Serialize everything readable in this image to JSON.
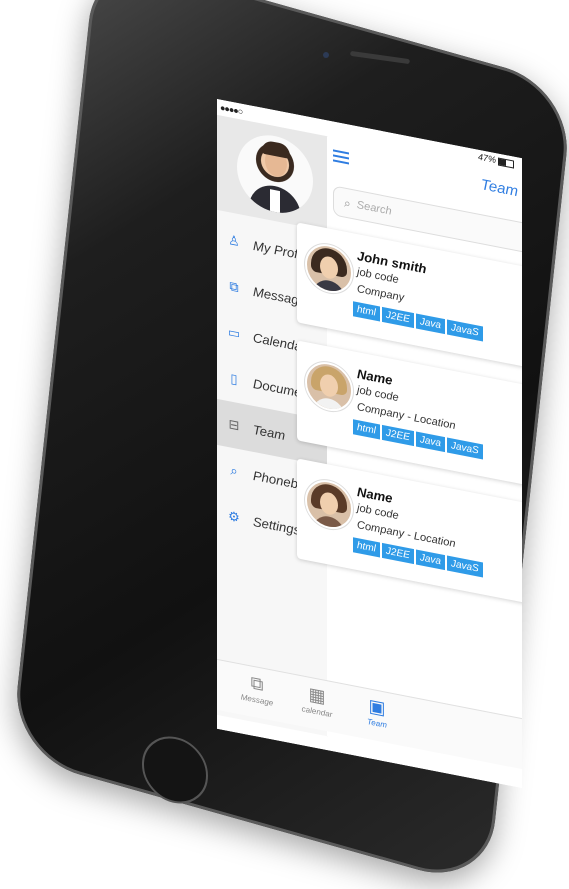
{
  "statusbar": {
    "signal": "●●●●○",
    "battery": "47%"
  },
  "header": {
    "title": "Team"
  },
  "search": {
    "placeholder": "Search"
  },
  "sidebar": {
    "items": [
      {
        "label": "My Profile",
        "icon": "user-icon",
        "glyph": "♙"
      },
      {
        "label": "Messages",
        "icon": "messages-icon",
        "glyph": "⧉"
      },
      {
        "label": "Calendar",
        "icon": "calendar-icon",
        "glyph": "▭"
      },
      {
        "label": "Documents",
        "icon": "document-icon",
        "glyph": "▯"
      },
      {
        "label": "Team",
        "icon": "briefcase-icon",
        "glyph": "⊟"
      },
      {
        "label": "Phonebook",
        "icon": "search-icon",
        "glyph": "⌕"
      },
      {
        "label": "Settings",
        "icon": "gear-icon",
        "glyph": "⚙"
      }
    ]
  },
  "team": {
    "members": [
      {
        "name": "John smith",
        "job": "job code",
        "company": "Company",
        "tags": [
          "html",
          "J2EE",
          "Java",
          "JavaS"
        ]
      },
      {
        "name": "Name",
        "job": "job code",
        "company": "Company - Location",
        "tags": [
          "html",
          "J2EE",
          "Java",
          "JavaS"
        ]
      },
      {
        "name": "Name",
        "job": "job code",
        "company": "Company - Location",
        "tags": [
          "html",
          "J2EE",
          "Java",
          "JavaS"
        ]
      }
    ]
  },
  "tabbar": {
    "tabs": [
      {
        "label": "Message",
        "icon": "chat-icon",
        "glyph": "⧉"
      },
      {
        "label": "calendar",
        "icon": "calendar-icon",
        "glyph": "▦"
      },
      {
        "label": "Team",
        "icon": "briefcase-icon",
        "glyph": "▣"
      }
    ]
  },
  "colors": {
    "accent": "#2f7de1",
    "tag": "#2f9be8"
  }
}
